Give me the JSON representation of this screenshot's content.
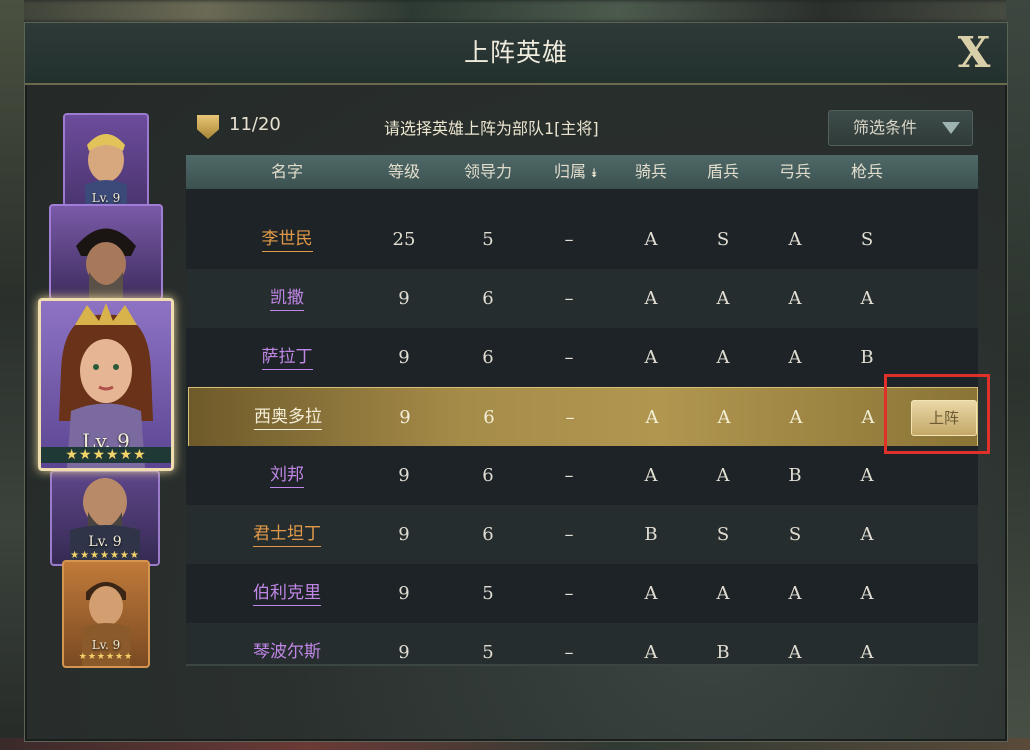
{
  "window": {
    "title": "上阵英雄",
    "close_label": "X"
  },
  "header": {
    "count": "11/20",
    "prompt": "请选择英雄上阵为部队1[主将]",
    "filter_label": "筛选条件"
  },
  "table": {
    "columns": [
      "名字",
      "等级",
      "领导力",
      "归属",
      "骑兵",
      "盾兵",
      "弓兵",
      "枪兵"
    ],
    "rows": [
      {
        "name": "李世民",
        "level": "25",
        "leadership": "5",
        "affiliation": "–",
        "cavalry": "A",
        "shield": "S",
        "archer": "A",
        "spear": "S",
        "color": "orange"
      },
      {
        "name": "凯撒",
        "level": "9",
        "leadership": "6",
        "affiliation": "–",
        "cavalry": "A",
        "shield": "A",
        "archer": "A",
        "spear": "A",
        "color": "purple"
      },
      {
        "name": "萨拉丁",
        "level": "9",
        "leadership": "6",
        "affiliation": "–",
        "cavalry": "A",
        "shield": "A",
        "archer": "A",
        "spear": "B",
        "color": "purple"
      },
      {
        "name": "西奥多拉",
        "level": "9",
        "leadership": "6",
        "affiliation": "–",
        "cavalry": "A",
        "shield": "A",
        "archer": "A",
        "spear": "A",
        "color": "purple",
        "selected": true
      },
      {
        "name": "刘邦",
        "level": "9",
        "leadership": "6",
        "affiliation": "–",
        "cavalry": "A",
        "shield": "A",
        "archer": "B",
        "spear": "A",
        "color": "purple"
      },
      {
        "name": "君士坦丁",
        "level": "9",
        "leadership": "6",
        "affiliation": "–",
        "cavalry": "B",
        "shield": "S",
        "archer": "S",
        "spear": "A",
        "color": "orange"
      },
      {
        "name": "伯利克里",
        "level": "9",
        "leadership": "5",
        "affiliation": "–",
        "cavalry": "A",
        "shield": "A",
        "archer": "A",
        "spear": "A",
        "color": "purple"
      },
      {
        "name": "琴波尔斯",
        "level": "9",
        "leadership": "5",
        "affiliation": "–",
        "cavalry": "A",
        "shield": "B",
        "archer": "A",
        "spear": "A",
        "color": "purple"
      }
    ],
    "deploy_label": "上阵"
  },
  "heroes": [
    {
      "level": "Lv. 9"
    },
    {
      "level": ""
    },
    {
      "level": "Lv. 9",
      "stars": "★★★★★★"
    },
    {
      "level": "Lv. 9",
      "stars": "★★★★★★★"
    },
    {
      "level": "Lv. 9",
      "stars": "★★★★★★"
    }
  ],
  "colors": {
    "orange_name": "#e39a48",
    "purple_name": "#c087e6",
    "highlight": "#e0302a"
  }
}
